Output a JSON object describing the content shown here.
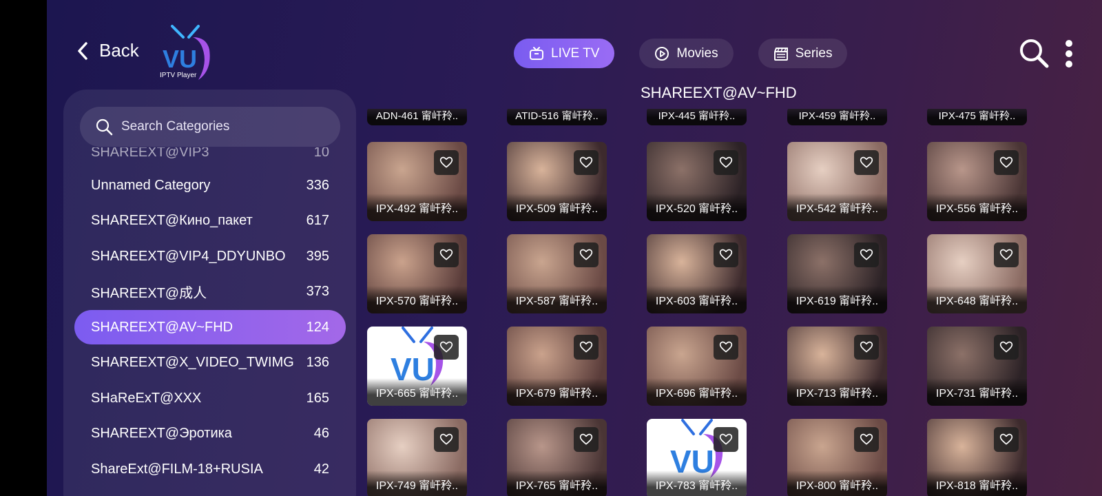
{
  "header": {
    "back_label": "Back",
    "logo_text": "IPTV Player",
    "logo_mark": "VU",
    "tabs": [
      {
        "label": "LIVE TV",
        "icon": "tv-icon",
        "active": true
      },
      {
        "label": "Movies",
        "icon": "play-icon",
        "active": false
      },
      {
        "label": "Series",
        "icon": "clapperboard-icon",
        "active": false
      }
    ]
  },
  "sidebar": {
    "search_placeholder": "Search Categories",
    "categories": [
      {
        "name": "SHAREEXT@VIP3",
        "count": "10"
      },
      {
        "name": "Unnamed Category",
        "count": "336"
      },
      {
        "name": "SHAREEXT@Кино_пакет",
        "count": "617"
      },
      {
        "name": "SHAREEXT@VIP4_DDYUNBO",
        "count": "395"
      },
      {
        "name": "SHAREEXT@成人",
        "count": "373"
      },
      {
        "name": "SHAREEXT@AV~FHD",
        "count": "124",
        "active": true
      },
      {
        "name": "SHAREEXT@X_VIDEO_TWIMG",
        "count": "136"
      },
      {
        "name": "SHaReExT@XXX",
        "count": "165"
      },
      {
        "name": "SHAREEXT@Эротика",
        "count": "46"
      },
      {
        "name": "ShareExt@FILM-18+RUSIA",
        "count": "42"
      }
    ]
  },
  "content": {
    "title": "SHAREEXT@AV~FHD",
    "top_row": [
      "ADN-461 甯屽矝..",
      "ATID-516 甯屽矝..",
      "IPX-445 甯屽矝..",
      "IPX-459 甯屽矝..",
      "IPX-475 甯屽矝.."
    ],
    "rows": [
      [
        {
          "label": "IPX-492 甯屽矝..",
          "thumb": "photo"
        },
        {
          "label": "IPX-509 甯屽矝..",
          "thumb": "photo"
        },
        {
          "label": "IPX-520 甯屽矝..",
          "thumb": "photo"
        },
        {
          "label": "IPX-542 甯屽矝..",
          "thumb": "photo"
        },
        {
          "label": "IPX-556 甯屽矝..",
          "thumb": "photo"
        }
      ],
      [
        {
          "label": "IPX-570 甯屽矝..",
          "thumb": "photo"
        },
        {
          "label": "IPX-587 甯屽矝..",
          "thumb": "photo"
        },
        {
          "label": "IPX-603 甯屽矝..",
          "thumb": "photo"
        },
        {
          "label": "IPX-619 甯屽矝..",
          "thumb": "photo"
        },
        {
          "label": "IPX-648 甯屽矝..",
          "thumb": "photo"
        }
      ],
      [
        {
          "label": "IPX-665 甯屽矝..",
          "thumb": "vu-logo"
        },
        {
          "label": "IPX-679 甯屽矝..",
          "thumb": "photo"
        },
        {
          "label": "IPX-696 甯屽矝..",
          "thumb": "photo"
        },
        {
          "label": "IPX-713 甯屽矝..",
          "thumb": "photo"
        },
        {
          "label": "IPX-731 甯屽矝..",
          "thumb": "photo"
        }
      ],
      [
        {
          "label": "IPX-749 甯屽矝..",
          "thumb": "photo"
        },
        {
          "label": "IPX-765 甯屽矝..",
          "thumb": "photo"
        },
        {
          "label": "IPX-783 甯屽矝..",
          "thumb": "vu-logo"
        },
        {
          "label": "IPX-800 甯屽矝..",
          "thumb": "photo"
        },
        {
          "label": "IPX-818 甯屽矝..",
          "thumb": "photo"
        }
      ]
    ]
  },
  "colors": {
    "accent": "#8b63f2",
    "background_start": "#1c1650",
    "background_end": "#4a2242"
  }
}
